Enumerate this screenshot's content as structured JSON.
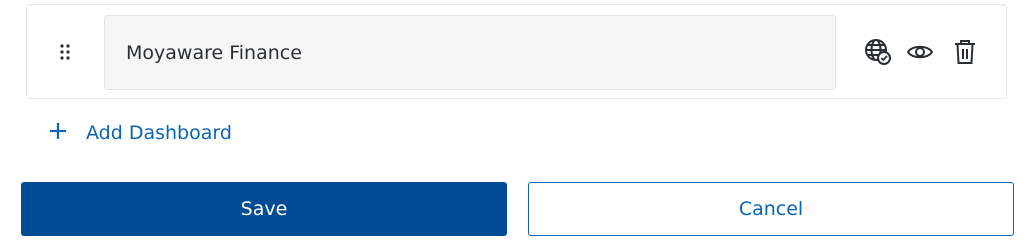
{
  "dashboard_row": {
    "name_value": "Moyaware Finance",
    "icons": {
      "drag": "drag-handle-icon",
      "globe": "globe-check-icon",
      "view": "eye-icon",
      "delete": "trash-icon"
    }
  },
  "add_dashboard": {
    "label": "Add Dashboard",
    "icon": "plus-icon"
  },
  "actions": {
    "save_label": "Save",
    "cancel_label": "Cancel"
  },
  "colors": {
    "primary": "#004b94",
    "link": "#0b64b5",
    "icon": "#2b2f33",
    "field_bg": "#f6f6f7",
    "border": "#e5e7eb"
  }
}
